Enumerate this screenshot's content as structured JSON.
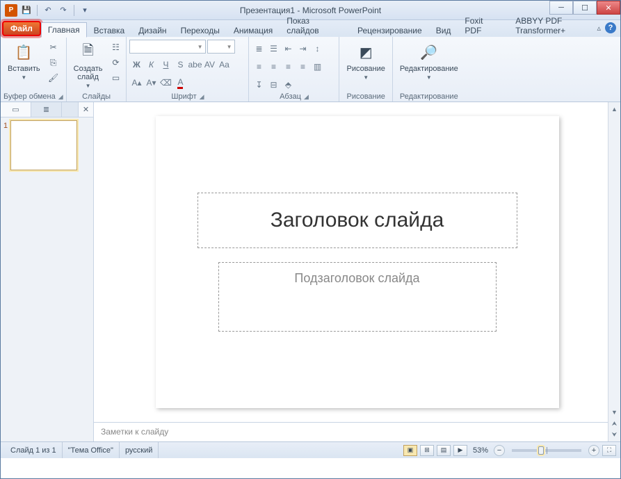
{
  "title": "Презентация1 - Microsoft PowerPoint",
  "tabs": {
    "file": "Файл",
    "home": "Главная",
    "insert": "Вставка",
    "design": "Дизайн",
    "transitions": "Переходы",
    "animations": "Анимация",
    "slideshow": "Показ слайдов",
    "review": "Рецензирование",
    "view": "Вид",
    "foxit": "Foxit PDF",
    "abbyy": "ABBYY PDF Transformer+"
  },
  "ribbon": {
    "clipboard": {
      "label": "Буфер обмена",
      "paste": "Вставить"
    },
    "slides": {
      "label": "Слайды",
      "new_slide": "Создать\nслайд"
    },
    "font": {
      "label": "Шрифт"
    },
    "paragraph": {
      "label": "Абзац"
    },
    "drawing": {
      "label": "Рисование",
      "btn": "Рисование"
    },
    "editing": {
      "label": "Редактирование",
      "btn": "Редактирование"
    }
  },
  "panel": {
    "thumb_num": "1"
  },
  "slide": {
    "title_placeholder": "Заголовок слайда",
    "subtitle_placeholder": "Подзаголовок слайда"
  },
  "notes": {
    "placeholder": "Заметки к слайду"
  },
  "status": {
    "slide_count": "Слайд 1 из 1",
    "theme": "\"Тема Office\"",
    "lang": "русский",
    "zoom": "53%"
  }
}
